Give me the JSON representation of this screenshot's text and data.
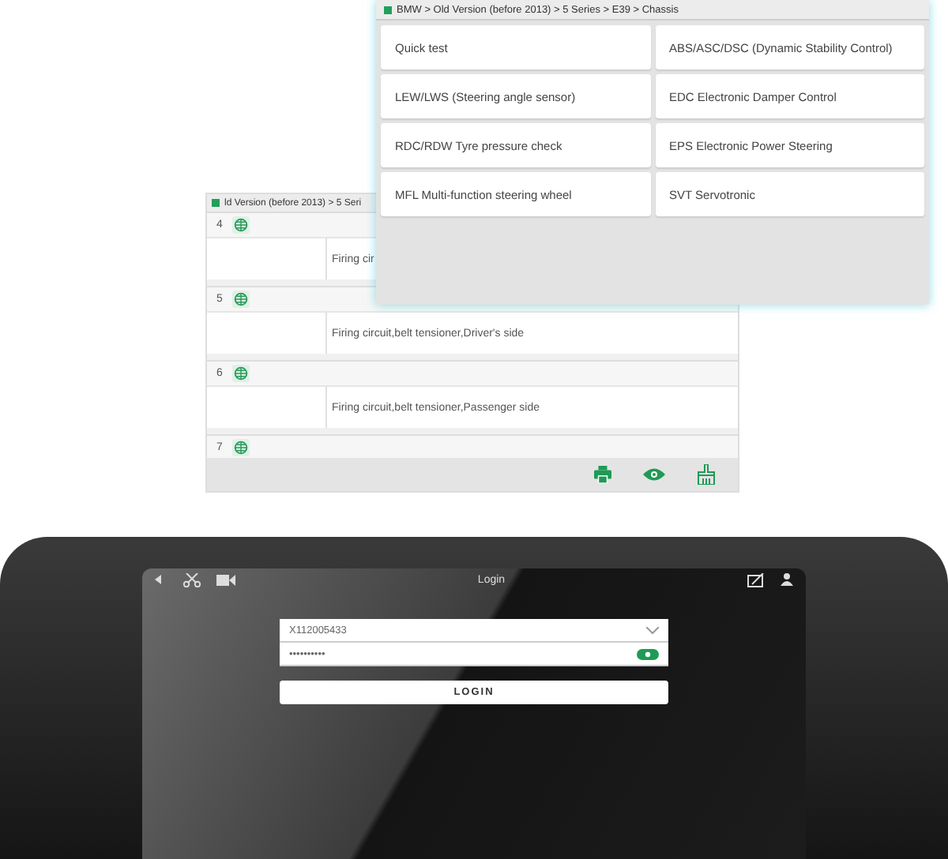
{
  "menu_window": {
    "breadcrumb": "BMW > Old Version (before 2013) > 5 Series > E39 > Chassis",
    "items": [
      {
        "label": "Quick test"
      },
      {
        "label": "ABS/ASC/DSC (Dynamic Stability Control)"
      },
      {
        "label": "LEW/LWS (Steering angle sensor)"
      },
      {
        "label": "EDC Electronic Damper Control"
      },
      {
        "label": "RDC/RDW Tyre pressure check"
      },
      {
        "label": "EPS Electronic Power Steering"
      },
      {
        "label": "MFL Multi-function steering wheel"
      },
      {
        "label": "SVT Servotronic"
      }
    ]
  },
  "list_window": {
    "breadcrumb": "ld Version (before 2013) > 5 Seri",
    "rows": [
      {
        "number": "4",
        "description": "Firing cir"
      },
      {
        "number": "5",
        "description": "Firing circuit,belt tensioner,Driver's side"
      },
      {
        "number": "6",
        "description": "Firing circuit,belt tensioner,Passenger side"
      },
      {
        "number": "7"
      }
    ]
  },
  "tablet": {
    "title": "Login",
    "username": "X112005433",
    "password": "••••••••••",
    "login_button": "LOGIN"
  }
}
